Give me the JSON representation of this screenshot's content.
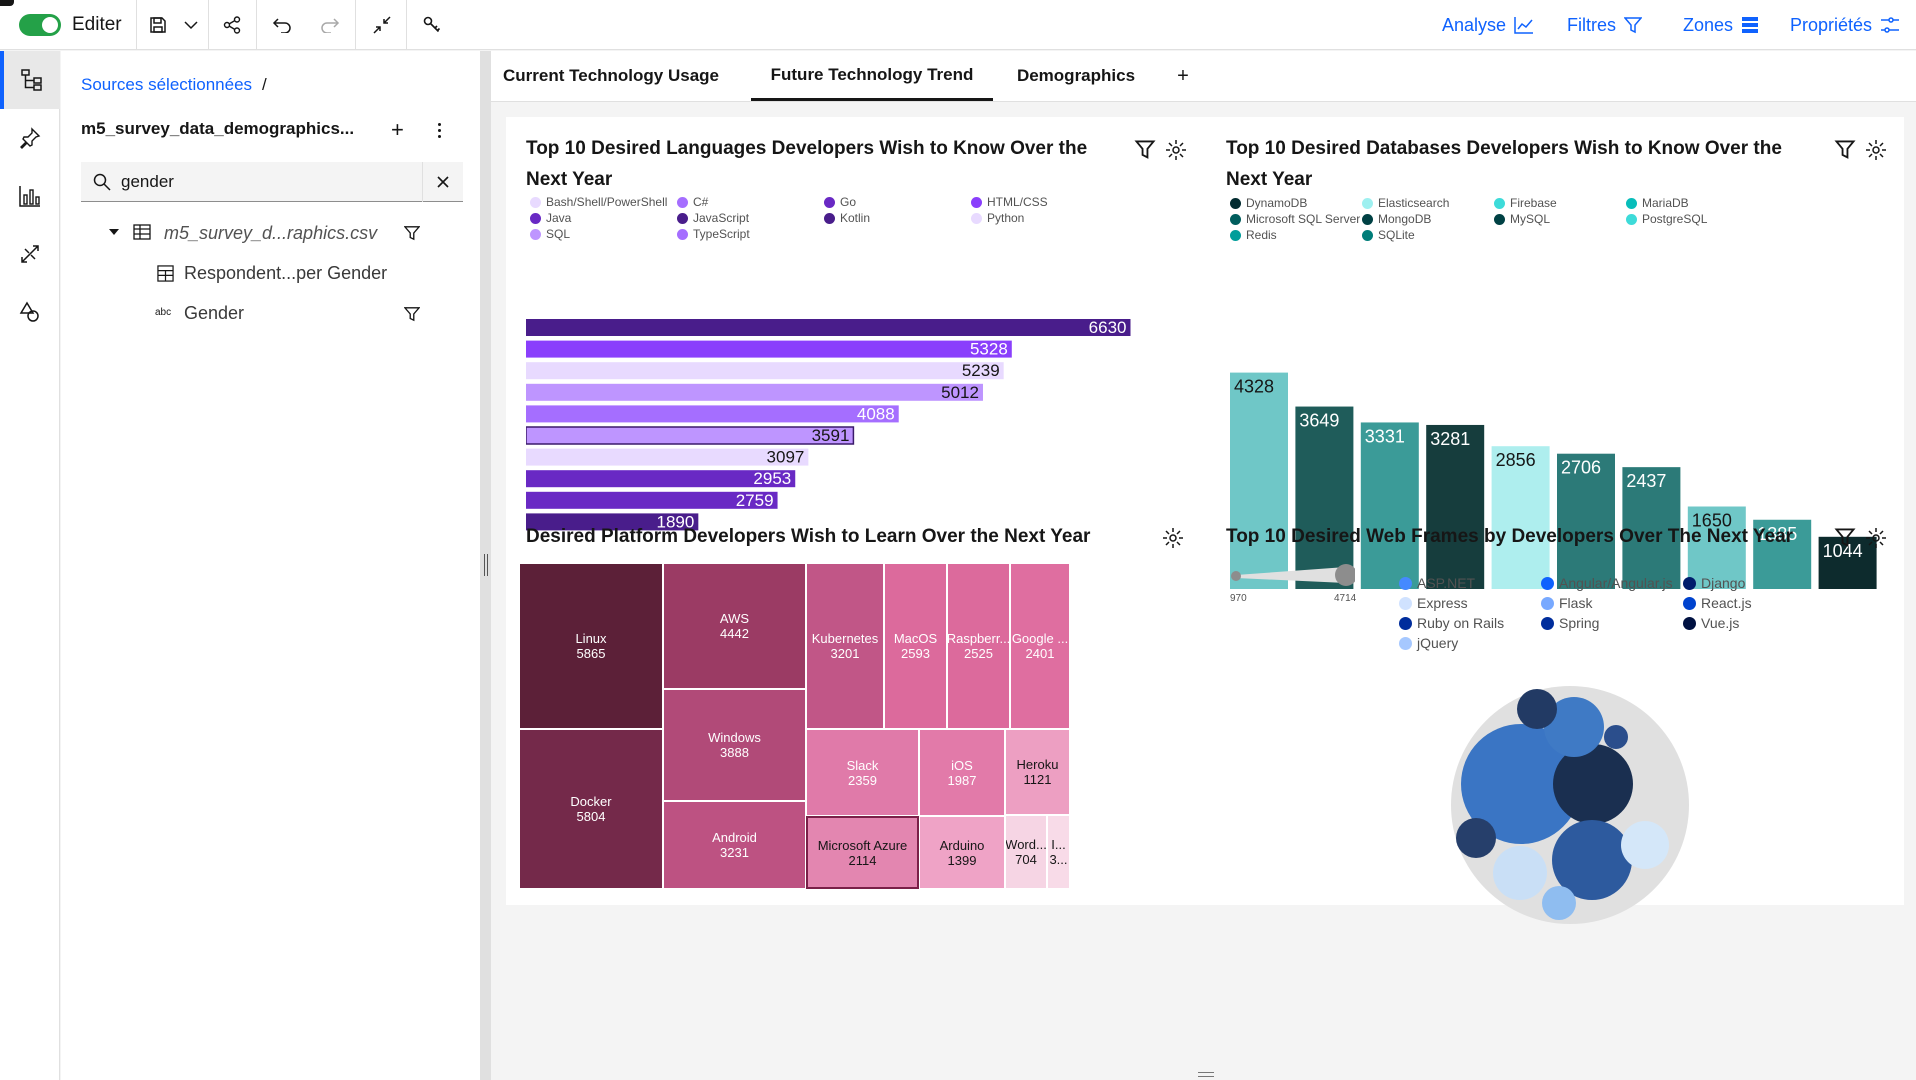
{
  "toolbar": {
    "edit_label": "Editer",
    "right": {
      "analyse": "Analyse",
      "filtres": "Filtres",
      "zones": "Zones",
      "proprietes": "Propriétés"
    }
  },
  "panel": {
    "breadcrumb": "Sources sélectionnées",
    "breadcrumb_sep": "/",
    "source_name": "m5_survey_data_demographics...",
    "search_value": "gender",
    "tree": {
      "file": "m5_survey_d...raphics.csv",
      "items": [
        "Respondent...per Gender",
        "Gender"
      ],
      "abc": "abc"
    }
  },
  "tabs": {
    "items": [
      "Current Technology Usage",
      "Future Technology Trend",
      "Demographics"
    ],
    "add": "+"
  },
  "cards": {
    "languages": {
      "title": "Top 10 Desired Languages Developers Wish to Know Over the Next Year",
      "legend": [
        {
          "label": "Bash/Shell/PowerShell",
          "color": "#e8daff"
        },
        {
          "label": "C#",
          "color": "#a56eff"
        },
        {
          "label": "Go",
          "color": "#6929c4"
        },
        {
          "label": "HTML/CSS",
          "color": "#8a3ffc"
        },
        {
          "label": "Java",
          "color": "#6929c4"
        },
        {
          "label": "JavaScript",
          "color": "#491d8b"
        },
        {
          "label": "Kotlin",
          "color": "#491d8b"
        },
        {
          "label": "Python",
          "color": "#e8daff"
        },
        {
          "label": "SQL",
          "color": "#be95ff"
        },
        {
          "label": "TypeScript",
          "color": "#a56eff"
        }
      ]
    },
    "databases": {
      "title": "Top 10 Desired Databases Developers Wish to Know Over the Next Year",
      "legend": [
        {
          "label": "DynamoDB",
          "color": "#022b30"
        },
        {
          "label": "Elasticsearch",
          "color": "#9ef0f0"
        },
        {
          "label": "Firebase",
          "color": "#3ddbd9"
        },
        {
          "label": "MariaDB",
          "color": "#08bdba"
        },
        {
          "label": "Microsoft SQL Server",
          "color": "#005d5d"
        },
        {
          "label": "MongoDB",
          "color": "#004144"
        },
        {
          "label": "MySQL",
          "color": "#004144"
        },
        {
          "label": "PostgreSQL",
          "color": "#3ddbd9"
        },
        {
          "label": "Redis",
          "color": "#009d9a"
        },
        {
          "label": "SQLite",
          "color": "#007d79"
        }
      ]
    },
    "platforms": {
      "title": "Desired Platform Developers Wish to Learn Over the Next Year"
    },
    "webframes": {
      "title": "Top 10 Desired Web Frames by Developers Over The Next Year",
      "slider": {
        "min": "970",
        "max": "4714"
      },
      "legend": [
        {
          "label": "ASP.NET",
          "color": "#4589ff"
        },
        {
          "label": "Angular/Angular.js",
          "color": "#0f62fe"
        },
        {
          "label": "Django",
          "color": "#001d6c"
        },
        {
          "label": "Express",
          "color": "#d0e2ff"
        },
        {
          "label": "Flask",
          "color": "#78a9ff"
        },
        {
          "label": "React.js",
          "color": "#0043ce"
        },
        {
          "label": "Ruby on Rails",
          "color": "#002d9c"
        },
        {
          "label": "Spring",
          "color": "#002d9c"
        },
        {
          "label": "Vue.js",
          "color": "#001141"
        },
        {
          "label": "jQuery",
          "color": "#a6c8ff"
        }
      ]
    }
  },
  "chart_data": [
    {
      "type": "bar",
      "orientation": "horizontal",
      "title": "Top 10 Desired Languages Developers Wish to Know Over the Next Year",
      "values": [
        6630,
        5328,
        5239,
        5012,
        4088,
        3591,
        3097,
        2953,
        2759,
        1890
      ],
      "colors": [
        "#491d8b",
        "#8a3ffc",
        "#e8daff",
        "#be95ff",
        "#a56eff",
        "#be95ff",
        "#e8daff",
        "#6929c4",
        "#6929c4",
        "#491d8b"
      ],
      "xlim": [
        0,
        6800
      ]
    },
    {
      "type": "bar",
      "title": "Top 10 Desired Databases Developers Wish to Know Over the Next Year",
      "values": [
        4328,
        3649,
        3331,
        3281,
        2856,
        2706,
        2437,
        1650,
        1385,
        1044
      ],
      "colors": [
        "#6fc7c7",
        "#1f5c5a",
        "#3b9b98",
        "#163d3d",
        "#aeeeee",
        "#2c7a78",
        "#2c7a78",
        "#6fc7c7",
        "#3b9b98",
        "#0d2b2d"
      ],
      "label_colors": [
        "#161616",
        "#ffffff",
        "#ffffff",
        "#ffffff",
        "#161616",
        "#ffffff",
        "#ffffff",
        "#161616",
        "#ffffff",
        "#ffffff"
      ],
      "ylim": [
        0,
        4500
      ]
    },
    {
      "type": "treemap",
      "title": "Desired Platform Developers Wish to Learn Over the Next Year",
      "items": [
        {
          "label": "Linux",
          "value": "5865",
          "color": "#5c2038"
        },
        {
          "label": "Docker",
          "value": "5804",
          "color": "#74294a"
        },
        {
          "label": "AWS",
          "value": "4442",
          "color": "#9b3b64"
        },
        {
          "label": "Windows",
          "value": "3888",
          "color": "#b14a78"
        },
        {
          "label": "Android",
          "value": "3231",
          "color": "#bd5282"
        },
        {
          "label": "Kubernetes",
          "value": "3201",
          "color": "#c15687"
        },
        {
          "label": "MacOS",
          "value": "2593",
          "color": "#dc6a9c"
        },
        {
          "label": "Raspberr...",
          "value": "2525",
          "color": "#dc6a9c"
        },
        {
          "label": "Google ...",
          "value": "2401",
          "color": "#df6ea0"
        },
        {
          "label": "Slack",
          "value": "2359",
          "color": "#e07aa9"
        },
        {
          "label": "iOS",
          "value": "1987",
          "color": "#e27aa9"
        },
        {
          "label": "Microsoft Azure",
          "value": "2114",
          "color": "#e386b0"
        },
        {
          "label": "Heroku",
          "value": "1121",
          "color": "#ed9fc2"
        },
        {
          "label": "Arduino",
          "value": "1399",
          "color": "#efa3c6"
        },
        {
          "label": "Word...",
          "value": "704",
          "color": "#f6d5e4"
        },
        {
          "label": "I...",
          "value": "3...",
          "color": "#f8dbe8"
        }
      ]
    },
    {
      "type": "bubble",
      "title": "Top 10 Desired Web Frames by Developers Over The Next Year",
      "range": [
        970,
        4714
      ]
    }
  ]
}
